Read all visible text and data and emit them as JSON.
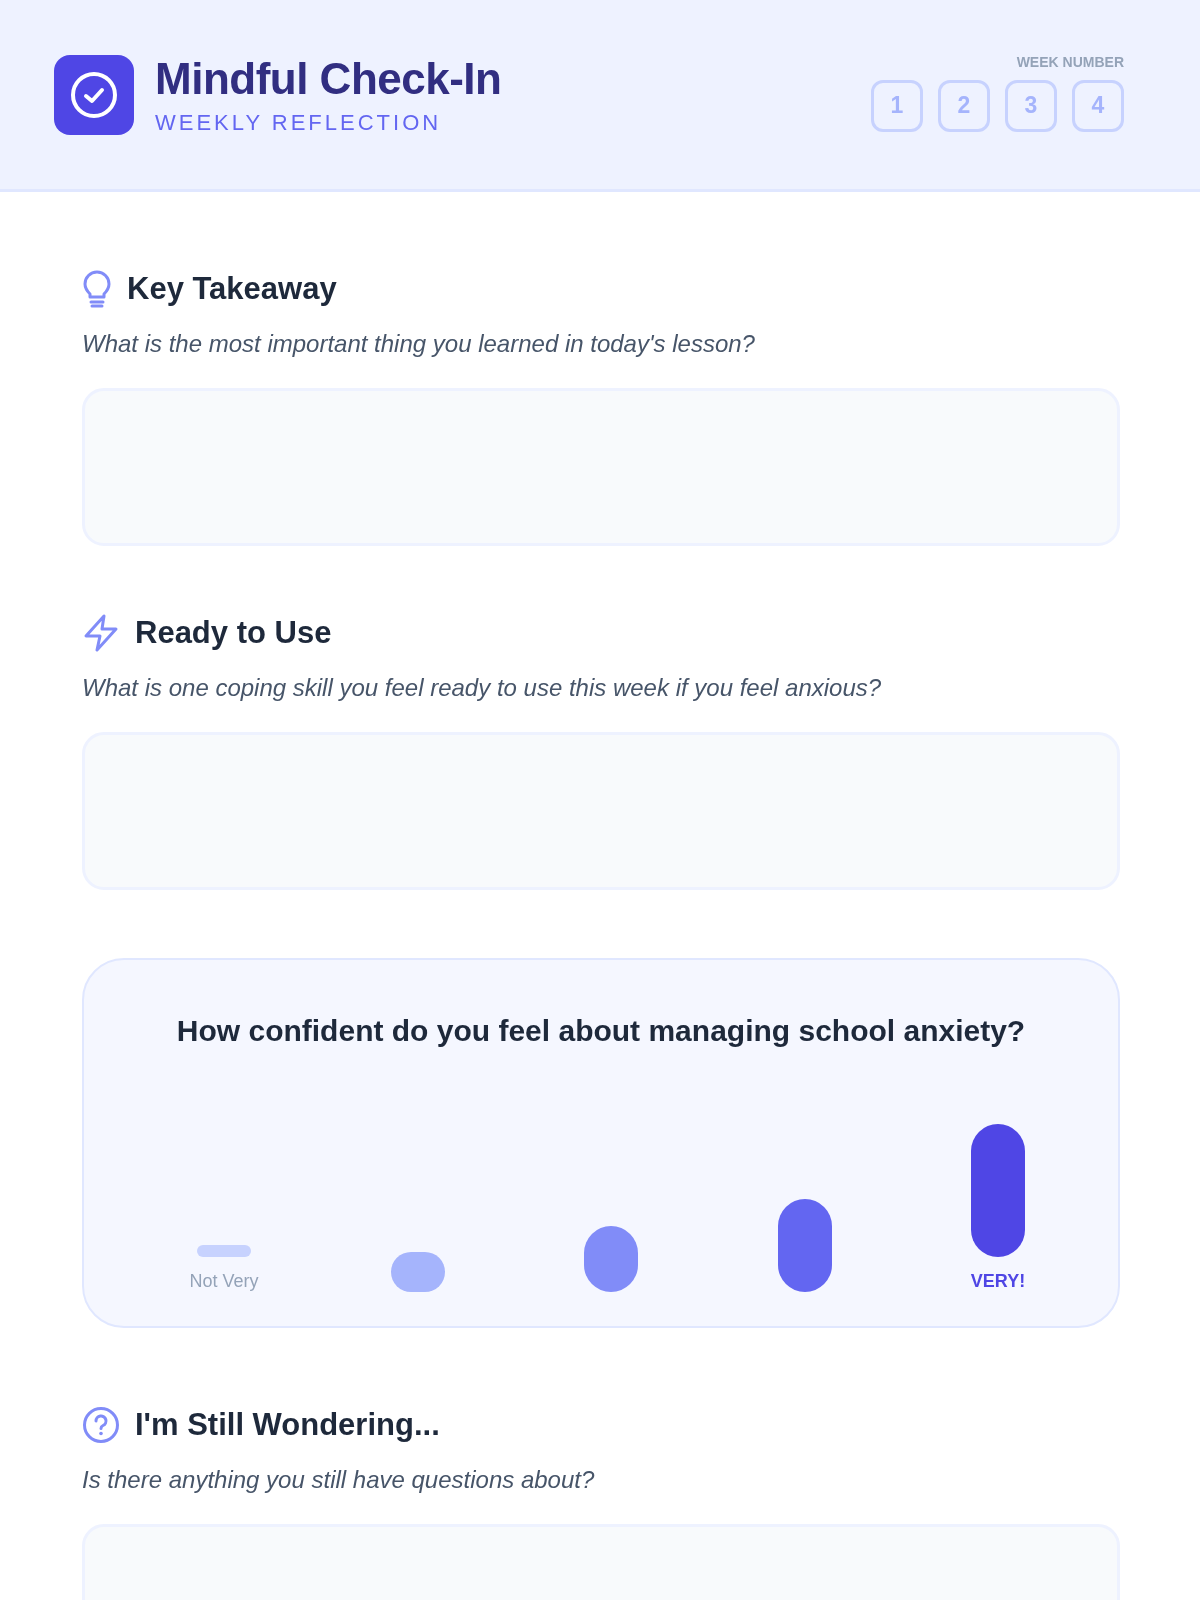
{
  "header": {
    "title": "Mindful Check-In",
    "subtitle": "WEEKLY REFLECTION",
    "week_label": "WEEK NUMBER",
    "weeks": [
      {
        "label": "1",
        "selected": false
      },
      {
        "label": "2",
        "selected": false
      },
      {
        "label": "3",
        "selected": false
      },
      {
        "label": "4",
        "selected": false
      }
    ]
  },
  "sections": [
    {
      "kind": "text",
      "heading": "Key Takeaway",
      "prompt": "What is the most important thing you learned in today's lesson?"
    },
    {
      "kind": "text",
      "heading": "Ready to Use",
      "prompt": "What is one coping skill you feel ready to use this week if you feel anxious?"
    },
    {
      "kind": "scale",
      "question": "How confident do you feel about managing school anxiety?",
      "options": [
        {
          "label": "Not Very",
          "color": "#c7d2fe"
        },
        {
          "color": "#a5b4fc"
        },
        {
          "color": "#818cf8"
        },
        {
          "color": "#6366f1"
        },
        {
          "label": "VERY!",
          "color": "#4f46e5"
        }
      ]
    },
    {
      "kind": "text",
      "heading": "I'm Still Wondering...",
      "prompt": "Is there anything you still have questions about?"
    }
  ]
}
